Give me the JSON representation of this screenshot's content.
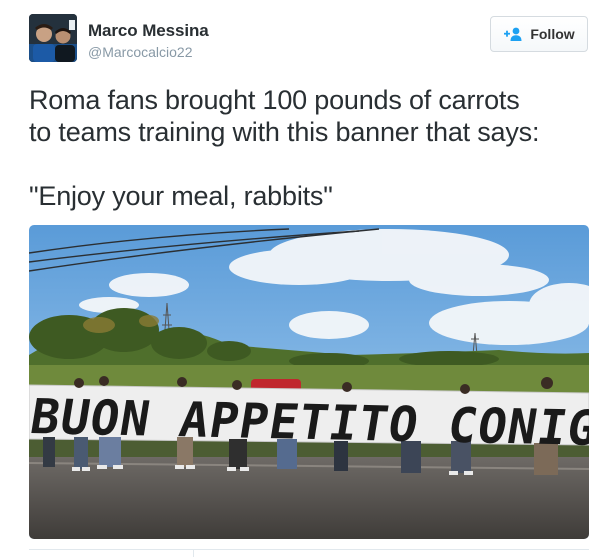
{
  "user": {
    "name": "Marco Messina",
    "handle": "@Marcocalcio22"
  },
  "follow_button": {
    "label": "Follow",
    "icon": "follow-person-plus-icon"
  },
  "tweet": {
    "lines": [
      "Roma fans brought 100 pounds of carrots",
      "to teams training with this banner that says:",
      "",
      "\"Enjoy your meal, rabbits\""
    ]
  },
  "photo": {
    "banner_text": "BUON APPETITO CONIGLI!"
  },
  "colors": {
    "text": "#292f33",
    "secondary": "#8899a6",
    "accent": "#1da1f2",
    "border": "#e1e8ed"
  }
}
